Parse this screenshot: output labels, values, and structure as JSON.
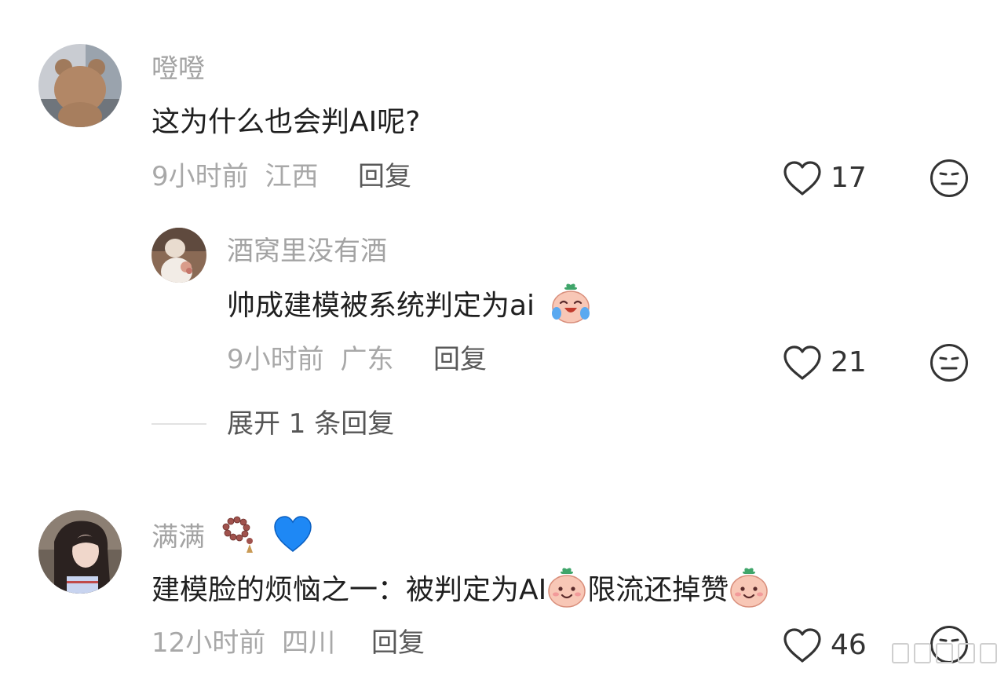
{
  "comments": [
    {
      "username": "噔噔",
      "text": "这为什么也会判AI呢?",
      "time": "9小时前",
      "location": "江西",
      "reply_label": "回复",
      "likes": "17",
      "avatar_icon": "bear-avatar"
    },
    {
      "username": "酒窝里没有酒",
      "text": "帅成建模被系统判定为ai",
      "text_emoji": "laugh-cry-emoji",
      "time": "9小时前",
      "location": "广东",
      "reply_label": "回复",
      "likes": "21",
      "avatar_icon": "bride-avatar"
    },
    {
      "username": "满满",
      "username_emojis": [
        "bead-bracelet-emoji",
        "blue-heart-emoji"
      ],
      "text_part1": "建模脸的烦恼之一：被判定为AI",
      "text_part2": "限流还掉赞",
      "text_emoji": "shy-smile-emoji",
      "time": "12小时前",
      "location": "四川",
      "reply_label": "回复",
      "likes": "46",
      "avatar_icon": "girl-avatar"
    }
  ],
  "expand_replies": "展开 1 条回复",
  "colors": {
    "username": "#a3a3a3",
    "meta": "#a8a8a8",
    "text": "#1f1f1f",
    "icon": "#333333",
    "blue_heart": "#1e88f5",
    "bracelet": "#a0524d"
  }
}
